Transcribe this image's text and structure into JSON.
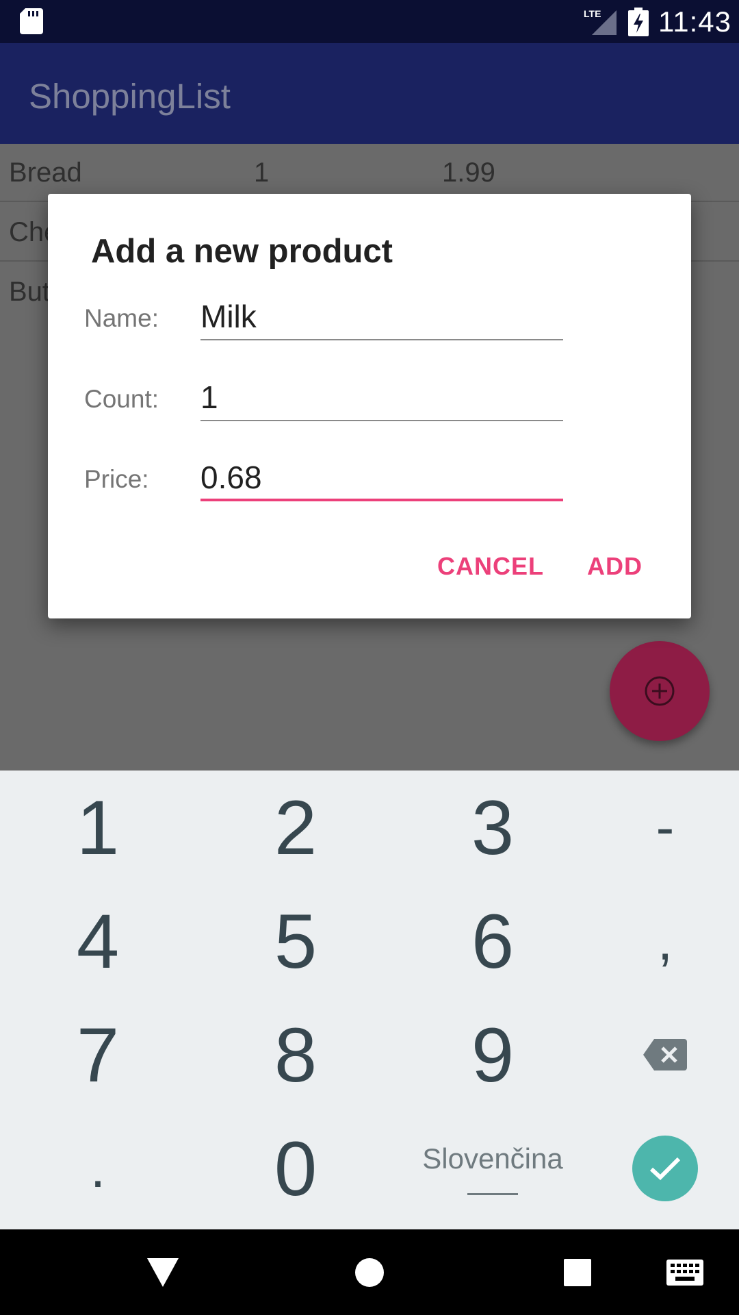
{
  "status_bar": {
    "time": "11:43",
    "icons": [
      "sd-card-icon",
      "lte-signal-icon",
      "battery-charging-icon"
    ]
  },
  "app_bar": {
    "title": "ShoppingList"
  },
  "list": {
    "rows": [
      {
        "name": "Bread",
        "count": "1",
        "price": "1.99"
      },
      {
        "name": "Che",
        "count": "",
        "price": ""
      },
      {
        "name": "But",
        "count": "",
        "price": ""
      }
    ]
  },
  "dialog": {
    "title": "Add a new product",
    "fields": {
      "name": {
        "label": "Name:",
        "value": "Milk"
      },
      "count": {
        "label": "Count:",
        "value": "1"
      },
      "price": {
        "label": "Price:",
        "value": "0.68"
      }
    },
    "cancel_label": "CANCEL",
    "add_label": "ADD"
  },
  "keyboard": {
    "keys": {
      "k1": "1",
      "k2": "2",
      "k3": "3",
      "minus": "-",
      "k4": "4",
      "k5": "5",
      "k6": "6",
      "comma": ",",
      "k7": "7",
      "k8": "8",
      "k9": "9",
      "dot": ".",
      "k0": "0"
    },
    "language": "Slovenčina",
    "icons": [
      "backspace-icon",
      "enter-check-icon"
    ]
  },
  "nav_bar": {
    "icons": [
      "back-icon",
      "home-icon",
      "recents-icon",
      "keyboard-switch-icon"
    ]
  },
  "colors": {
    "accent": "#ec407a",
    "app_bar": "#1a2260",
    "status_bar": "#0b0f33",
    "enter_key": "#4db6ac",
    "fab": "#8e1c45"
  }
}
